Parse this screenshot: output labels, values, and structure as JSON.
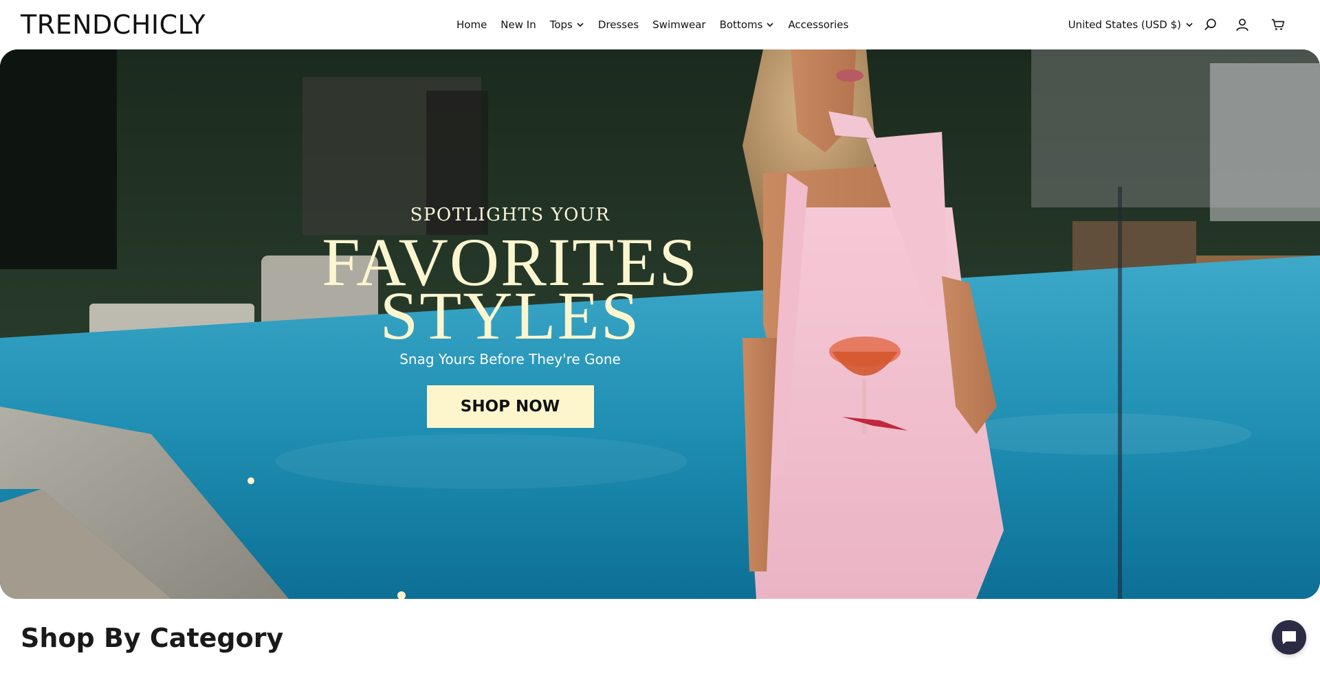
{
  "header": {
    "logo": "TRENDCHICLY",
    "nav": [
      {
        "label": "Home"
      },
      {
        "label": "New In"
      },
      {
        "label": "Tops"
      },
      {
        "label": "Dresses"
      },
      {
        "label": "Swimwear"
      },
      {
        "label": "Bottoms"
      },
      {
        "label": "Accessories"
      }
    ],
    "currency": "United States (USD $)",
    "icons": [
      "search-icon",
      "account-icon",
      "cart-icon"
    ]
  },
  "hero": {
    "pre_title": "SPOTLIGHTS YOUR",
    "title_line1": "FAVORITES",
    "title_line2": "STYLES",
    "subtitle": "Snag Yours Before They're Gone",
    "cta_label": "SHOP NOW"
  },
  "sections": {
    "category_title": "Shop By Category"
  },
  "colors": {
    "accent_cream": "#fdf6cd",
    "chat_bubble": "#2b2b46",
    "text": "#111111"
  }
}
